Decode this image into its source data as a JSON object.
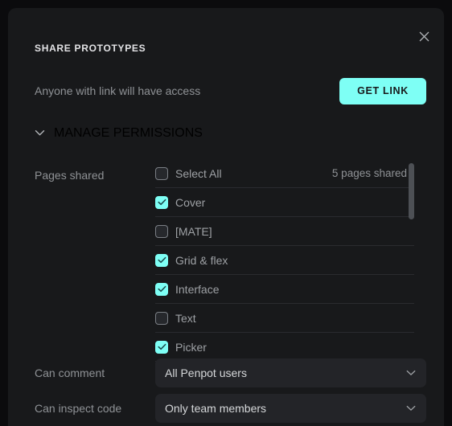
{
  "modal": {
    "title": "SHARE PROTOTYPES",
    "close_icon": "close-icon"
  },
  "link_section": {
    "description": "Anyone with link will have access",
    "button_label": "GET LINK"
  },
  "permissions": {
    "header_label": "MANAGE PERMISSIONS",
    "chevron_icon": "chevron-down-icon",
    "expanded": true
  },
  "pages": {
    "label": "Pages shared",
    "count_text": "5 pages shared",
    "items": [
      {
        "label": "Select All",
        "checked": false
      },
      {
        "label": "Cover",
        "checked": true
      },
      {
        "label": "[MATE]",
        "checked": false
      },
      {
        "label": "Grid & flex",
        "checked": true
      },
      {
        "label": "Interface",
        "checked": true
      },
      {
        "label": "Text",
        "checked": false
      },
      {
        "label": "Picker",
        "checked": true
      }
    ]
  },
  "selects": [
    {
      "label": "Can comment",
      "value": "All Penpot users",
      "caret_icon": "chevron-down-icon"
    },
    {
      "label": "Can inspect code",
      "value": "Only team members",
      "caret_icon": "chevron-down-icon"
    }
  ],
  "colors": {
    "accent": "#7efff5",
    "modal_bg": "#18191b",
    "page_bg": "#0b0b0d",
    "select_bg": "#232428",
    "text_muted": "#8f9296",
    "divider": "#2a2b2f"
  }
}
